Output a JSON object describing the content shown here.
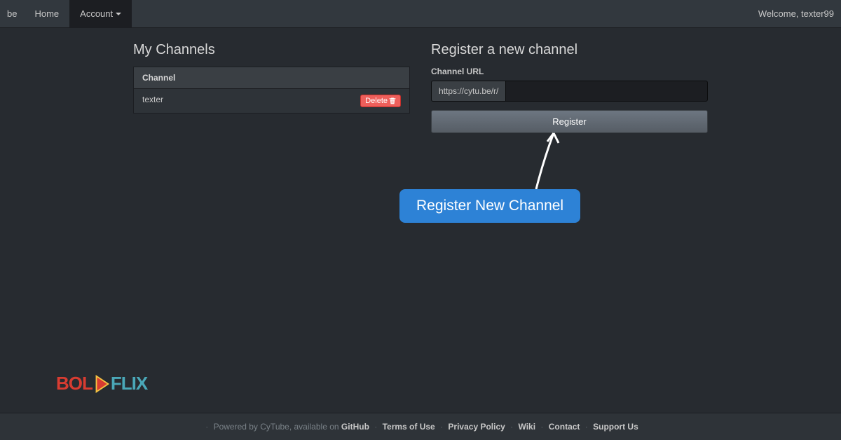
{
  "nav": {
    "brand_suffix": "be",
    "home": "Home",
    "account": "Account",
    "welcome": "Welcome, texter99"
  },
  "my_channels": {
    "heading": "My Channels",
    "col_header": "Channel",
    "rows": [
      {
        "name": "texter",
        "delete_label": "Delete"
      }
    ]
  },
  "register": {
    "heading": "Register a new channel",
    "label": "Channel URL",
    "prefix": "https://cytu.be/r/",
    "input_value": "",
    "button": "Register"
  },
  "annotation": {
    "label": "Register New Channel"
  },
  "logo": {
    "part1": "BOL",
    "part2": "FLIX"
  },
  "footer": {
    "prefix": "Powered by CyTube, available on",
    "links": [
      "GitHub",
      "Terms of Use",
      "Privacy Policy",
      "Wiki",
      "Contact",
      "Support Us"
    ]
  }
}
